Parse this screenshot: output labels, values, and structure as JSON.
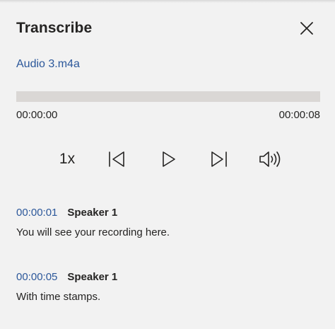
{
  "header": {
    "title": "Transcribe",
    "close_icon": "close-icon"
  },
  "file": {
    "name": "Audio 3.m4a"
  },
  "player": {
    "current_time": "00:00:00",
    "total_time": "00:00:08",
    "progress_fraction": 0,
    "speed_label": "1x",
    "icons": {
      "previous": "skip-previous-icon",
      "play": "play-icon",
      "next": "skip-next-icon",
      "volume": "volume-icon"
    }
  },
  "transcript": [
    {
      "timestamp": "00:00:01",
      "speaker": "Speaker 1",
      "text": "You will see your recording here."
    },
    {
      "timestamp": "00:00:05",
      "speaker": "Speaker 1",
      "text": "With time stamps."
    }
  ],
  "colors": {
    "accent": "#2b579a",
    "background": "#f2f2f2",
    "track": "#dad7d5",
    "text": "#252423"
  }
}
